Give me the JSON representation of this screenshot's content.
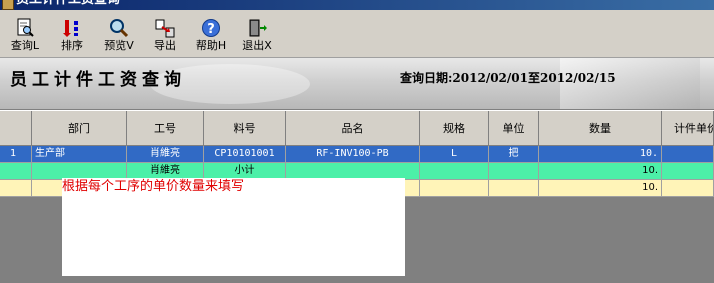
{
  "window": {
    "title": "员工计件工资查询"
  },
  "toolbar": {
    "buttons": [
      {
        "label": "查询L",
        "icon": "query-document-icon"
      },
      {
        "label": "排序",
        "icon": "sort-icon"
      },
      {
        "label": "预览V",
        "icon": "preview-magnifier-icon"
      },
      {
        "label": "导出",
        "icon": "export-icon"
      },
      {
        "label": "帮助H",
        "icon": "help-icon"
      },
      {
        "label": "退出X",
        "icon": "exit-door-icon"
      }
    ]
  },
  "banner": {
    "title": "员工计件工资查询",
    "date_range": "查询日期:2012/02/01至2012/02/15"
  },
  "table": {
    "columns": [
      "部门",
      "工号",
      "料号",
      "品名",
      "规格",
      "单位",
      "数量",
      "计件单价"
    ],
    "rows": [
      {
        "num": "1",
        "dept": "生产部",
        "emp": "肖維亮",
        "part": "CP10101001",
        "name": "RF-INV100-PB",
        "spec": "L",
        "unit": "把",
        "qty": "10."
      },
      {
        "num": "",
        "dept": "",
        "emp": "肖維亮",
        "part": "小计",
        "name": "",
        "spec": "",
        "unit": "",
        "qty": "10."
      },
      {
        "num": "",
        "dept": "",
        "emp": "",
        "part": "",
        "name": "",
        "spec": "",
        "unit": "",
        "qty": "10."
      }
    ]
  },
  "note": {
    "text": "根据每个工序的单价数量来填写"
  },
  "colors": {
    "selection": "#316ac5",
    "subtotal_row": "#4cf0a8",
    "total_row": "#fff4b8",
    "note_text": "#e00000"
  }
}
